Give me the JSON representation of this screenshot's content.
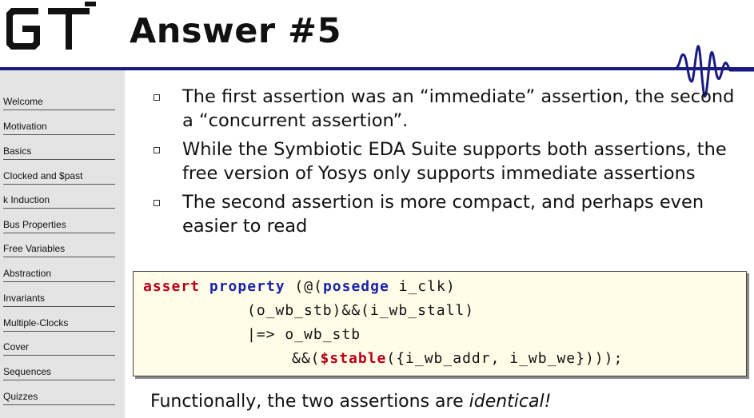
{
  "slide": {
    "title": "Answer #5"
  },
  "sidebar": {
    "items": [
      {
        "label": "Welcome"
      },
      {
        "label": "Motivation"
      },
      {
        "label": "Basics"
      },
      {
        "label": "Clocked and $past"
      },
      {
        "label": "k Induction"
      },
      {
        "label": "Bus Properties"
      },
      {
        "label": "Free Variables"
      },
      {
        "label": "Abstraction"
      },
      {
        "label": "Invariants"
      },
      {
        "label": "Multiple-Clocks"
      },
      {
        "label": "Cover"
      },
      {
        "label": "Sequences"
      },
      {
        "label": "Quizzes"
      }
    ]
  },
  "bullets": [
    {
      "line1": "The first assertion was an “immediate” assertion, the second",
      "line2": "a “concurrent assertion”."
    },
    {
      "line1": "While the Symbiotic EDA Suite supports both assertions, the",
      "line2": "free version of Yosys only supports immediate assertions"
    },
    {
      "line1": "The second assertion is more compact, and perhaps even",
      "line2": "easier to read"
    }
  ],
  "code": {
    "line1_kw1": "assert",
    "line1_kw2": "property",
    "line1_a": " (@(",
    "line1_kw3": "posedge",
    "line1_b": " i_clk)",
    "line2": "(o_wb_stb)&&(i_wb_stall)",
    "line3": "|=> o_wb_stb",
    "line4_a": "&&(",
    "line4_kw": "$stable",
    "line4_b": "({i_wb_addr, i_wb_we})));"
  },
  "footer": {
    "text_before": "Functionally, the two assertions are ",
    "text_emph": "identical!"
  },
  "colors": {
    "accent_navy": "#1a1a80",
    "keyword_red": "#b8001a",
    "keyword_blue": "#1a24a8",
    "sidebar_bg": "#e4e4e4",
    "code_bg": "#fffde8"
  }
}
